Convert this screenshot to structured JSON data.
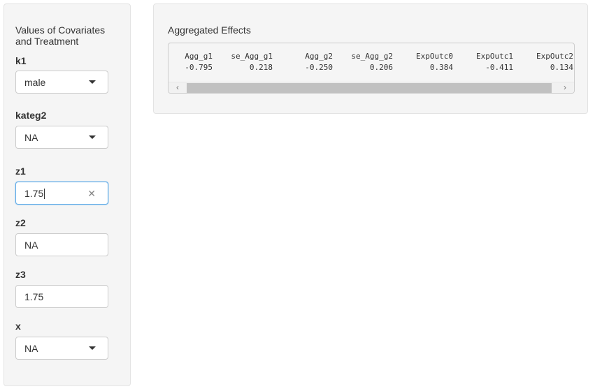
{
  "sidebar": {
    "title": "Values of Covariates and Treatment",
    "fields": {
      "k1": {
        "label": "k1",
        "value": "male"
      },
      "kateg2": {
        "label": "kateg2",
        "value": "NA"
      },
      "z1": {
        "label": "z1",
        "value": "1.75"
      },
      "z2": {
        "label": "z2",
        "value": "NA"
      },
      "z3": {
        "label": "z3",
        "value": "1.75"
      },
      "x": {
        "label": "x",
        "value": "NA"
      }
    }
  },
  "main": {
    "title": "Aggregated Effects",
    "table": {
      "headers": [
        "Agg_g1",
        "se_Agg_g1",
        "Agg_g2",
        "se_Agg_g2",
        "ExpOutc0",
        "ExpOutc1",
        "ExpOutc2"
      ],
      "values": [
        "-0.795",
        "0.218",
        "-0.250",
        "0.206",
        "0.384",
        "-0.411",
        "0.134"
      ]
    },
    "scrollbar": {
      "left_arrow": "‹",
      "right_arrow": "›"
    }
  },
  "icons": {
    "dropdown": "caret-down-icon",
    "clear": "close-icon"
  },
  "colors": {
    "panel_bg": "#f5f5f5",
    "focus_border": "#66afe9",
    "scroll_thumb": "#c1c1c1"
  }
}
